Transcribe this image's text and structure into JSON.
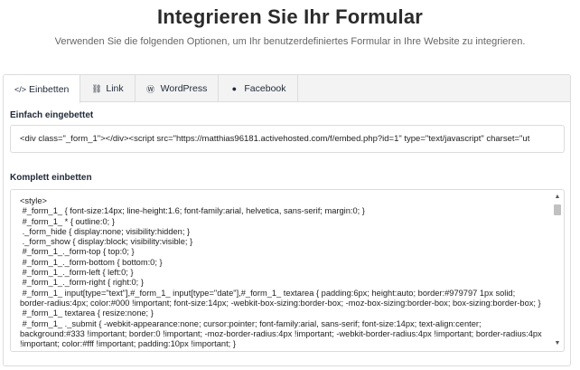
{
  "header": {
    "title": "Integrieren Sie Ihr Formular",
    "subtitle": "Verwenden Sie die folgenden Optionen, um Ihr benutzerdefiniertes Formular in Ihre Website zu integrieren."
  },
  "tabs": [
    {
      "label": "Einbetten",
      "icon": "code-icon",
      "glyph": "</>",
      "active": true
    },
    {
      "label": "Link",
      "icon": "link-icon",
      "glyph": "⛓",
      "active": false
    },
    {
      "label": "WordPress",
      "icon": "wordpress-icon",
      "glyph": "Ⓦ",
      "active": false
    },
    {
      "label": "Facebook",
      "icon": "facebook-icon",
      "glyph": "●",
      "active": false
    }
  ],
  "simple_embed": {
    "label": "Einfach eingebettet",
    "value": "<div class=\"_form_1\"></div><script src=\"https://matthias96181.activehosted.com/f/embed.php?id=1\" type=\"text/javascript\" charset=\"ut"
  },
  "full_embed": {
    "label": "Komplett einbetten",
    "code": "<style>\n #_form_1_ { font-size:14px; line-height:1.6; font-family:arial, helvetica, sans-serif; margin:0; }\n #_form_1_ * { outline:0; }\n ._form_hide { display:none; visibility:hidden; }\n ._form_show { display:block; visibility:visible; }\n #_form_1_._form-top { top:0; }\n #_form_1_._form-bottom { bottom:0; }\n #_form_1_._form-left { left:0; }\n #_form_1_._form-right { right:0; }\n #_form_1_ input[type=\"text\"],#_form_1_ input[type=\"date\"],#_form_1_ textarea { padding:6px; height:auto; border:#979797 1px solid; border-radius:4px; color:#000 !important; font-size:14px; -webkit-box-sizing:border-box; -moz-box-sizing:border-box; box-sizing:border-box; }\n #_form_1_ textarea { resize:none; }\n #_form_1_ ._submit { -webkit-appearance:none; cursor:pointer; font-family:arial, sans-serif; font-size:14px; text-align:center; background:#333 !important; border:0 !important; -moz-border-radius:4px !important; -webkit-border-radius:4px !important; border-radius:4px !important; color:#fff !important; padding:10px !important; }"
  }
}
